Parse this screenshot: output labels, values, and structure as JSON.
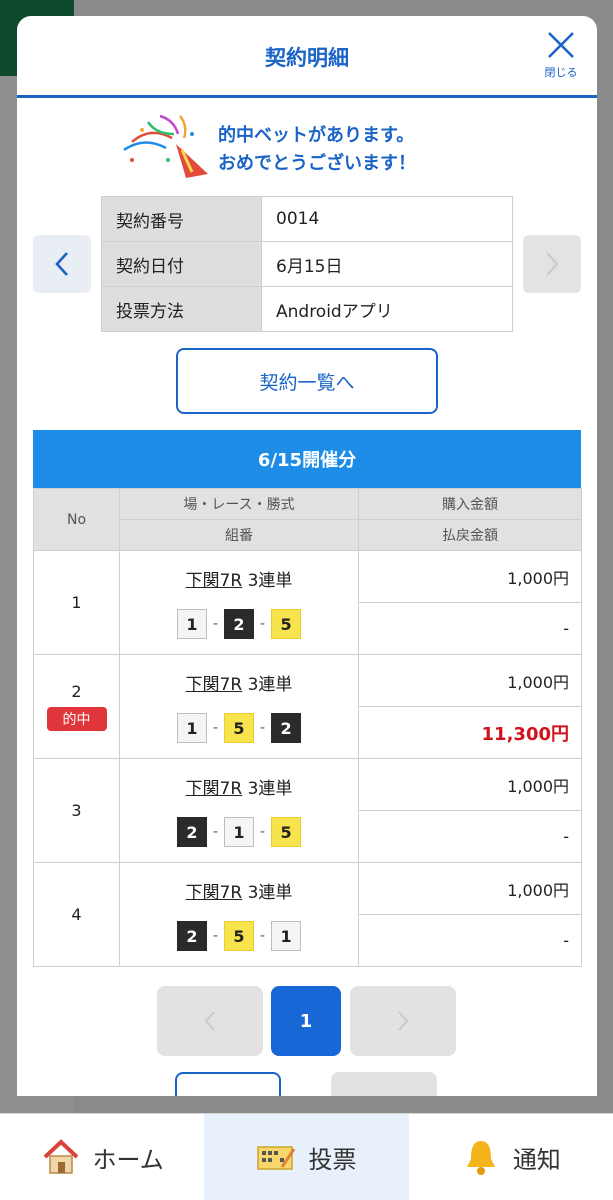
{
  "modal": {
    "title": "契約明細",
    "close_label": "閉じる",
    "win_line1": "的中ベットがあります。",
    "win_line2": "おめでとうございます！"
  },
  "contract": {
    "rows": [
      {
        "key": "契約番号",
        "value": "0014"
      },
      {
        "key": "契約日付",
        "value": "6月15日"
      },
      {
        "key": "投票方法",
        "value": "Androidアプリ"
      }
    ],
    "list_button": "契約一覧へ"
  },
  "section": {
    "title": "6/15開催分",
    "headers": {
      "no": "No",
      "race": "場・レース・勝式",
      "combo": "組番",
      "purchase": "購入金額",
      "payout": "払戻金額"
    }
  },
  "bets": [
    {
      "no": "1",
      "hit": false,
      "race": "下関7R",
      "type": "3連単",
      "combo": [
        {
          "n": "1",
          "c": "w"
        },
        {
          "n": "2",
          "c": "b"
        },
        {
          "n": "5",
          "c": "y"
        }
      ],
      "purchase": "1,000円",
      "payout": "-"
    },
    {
      "no": "2",
      "hit": true,
      "hit_label": "的中",
      "race": "下関7R",
      "type": "3連単",
      "combo": [
        {
          "n": "1",
          "c": "w"
        },
        {
          "n": "5",
          "c": "y"
        },
        {
          "n": "2",
          "c": "b"
        }
      ],
      "purchase": "1,000円",
      "payout": "11,300円"
    },
    {
      "no": "3",
      "hit": false,
      "race": "下関7R",
      "type": "3連単",
      "combo": [
        {
          "n": "2",
          "c": "b"
        },
        {
          "n": "1",
          "c": "w"
        },
        {
          "n": "5",
          "c": "y"
        }
      ],
      "purchase": "1,000円",
      "payout": "-"
    },
    {
      "no": "4",
      "hit": false,
      "race": "下関7R",
      "type": "3連単",
      "combo": [
        {
          "n": "2",
          "c": "b"
        },
        {
          "n": "5",
          "c": "y"
        },
        {
          "n": "1",
          "c": "w"
        }
      ],
      "purchase": "1,000円",
      "payout": "-"
    }
  ],
  "pager": {
    "current": "1"
  },
  "nav": {
    "home": "ホーム",
    "vote": "投票",
    "notice": "通知"
  },
  "colors": {
    "accent": "#1a63c7",
    "header_bar": "#1e8de8",
    "win_red": "#d1121d",
    "boat_yellow": "#f7e34c",
    "boat_black": "#2b2b2b"
  }
}
